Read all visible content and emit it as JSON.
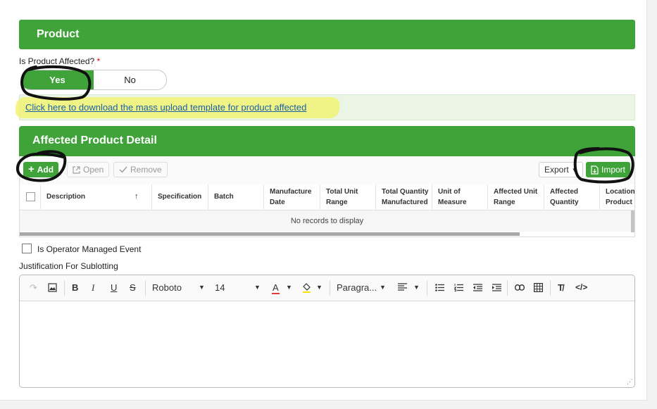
{
  "product_section": {
    "title": "Product"
  },
  "affected_question": {
    "label": "Is Product Affected?",
    "required_mark": "*"
  },
  "toggle": {
    "yes": "Yes",
    "no": "No",
    "selected": "Yes"
  },
  "template_link": {
    "text": "Click here to download the mass upload template for product affected"
  },
  "detail_section": {
    "title": "Affected Product Detail"
  },
  "grid_toolbar": {
    "add": "Add",
    "open": "Open",
    "remove": "Remove",
    "export": "Export",
    "import": "Import"
  },
  "grid": {
    "columns": [
      {
        "line1": "Description",
        "line2": "",
        "sort": "↑"
      },
      {
        "line1": "Specification",
        "line2": ""
      },
      {
        "line1": "Batch",
        "line2": ""
      },
      {
        "line1": "Manufacture",
        "line2": "Date"
      },
      {
        "line1": "Total Unit",
        "line2": "Range"
      },
      {
        "line1": "Total Quantity",
        "line2": "Manufactured"
      },
      {
        "line1": "Unit of",
        "line2": "Measure"
      },
      {
        "line1": "Affected Unit",
        "line2": "Range"
      },
      {
        "line1": "Affected",
        "line2": "Quantity"
      },
      {
        "line1": "Location o",
        "line2": "Product"
      }
    ],
    "empty_text": "No records to display"
  },
  "operator_managed": {
    "label": "Is Operator Managed Event",
    "checked": false
  },
  "justification": {
    "label": "Justification For Sublotting"
  },
  "editor_toolbar": {
    "font": "Roboto",
    "size": "14",
    "paragraph": "Paragra...",
    "text_color": "#e53935",
    "highlight_color": "#f5e400"
  },
  "colors": {
    "accent": "#3fa33a",
    "link": "#1b5fa8",
    "link_bar": "#eaf5e6",
    "highlighter": "#f2f266"
  }
}
